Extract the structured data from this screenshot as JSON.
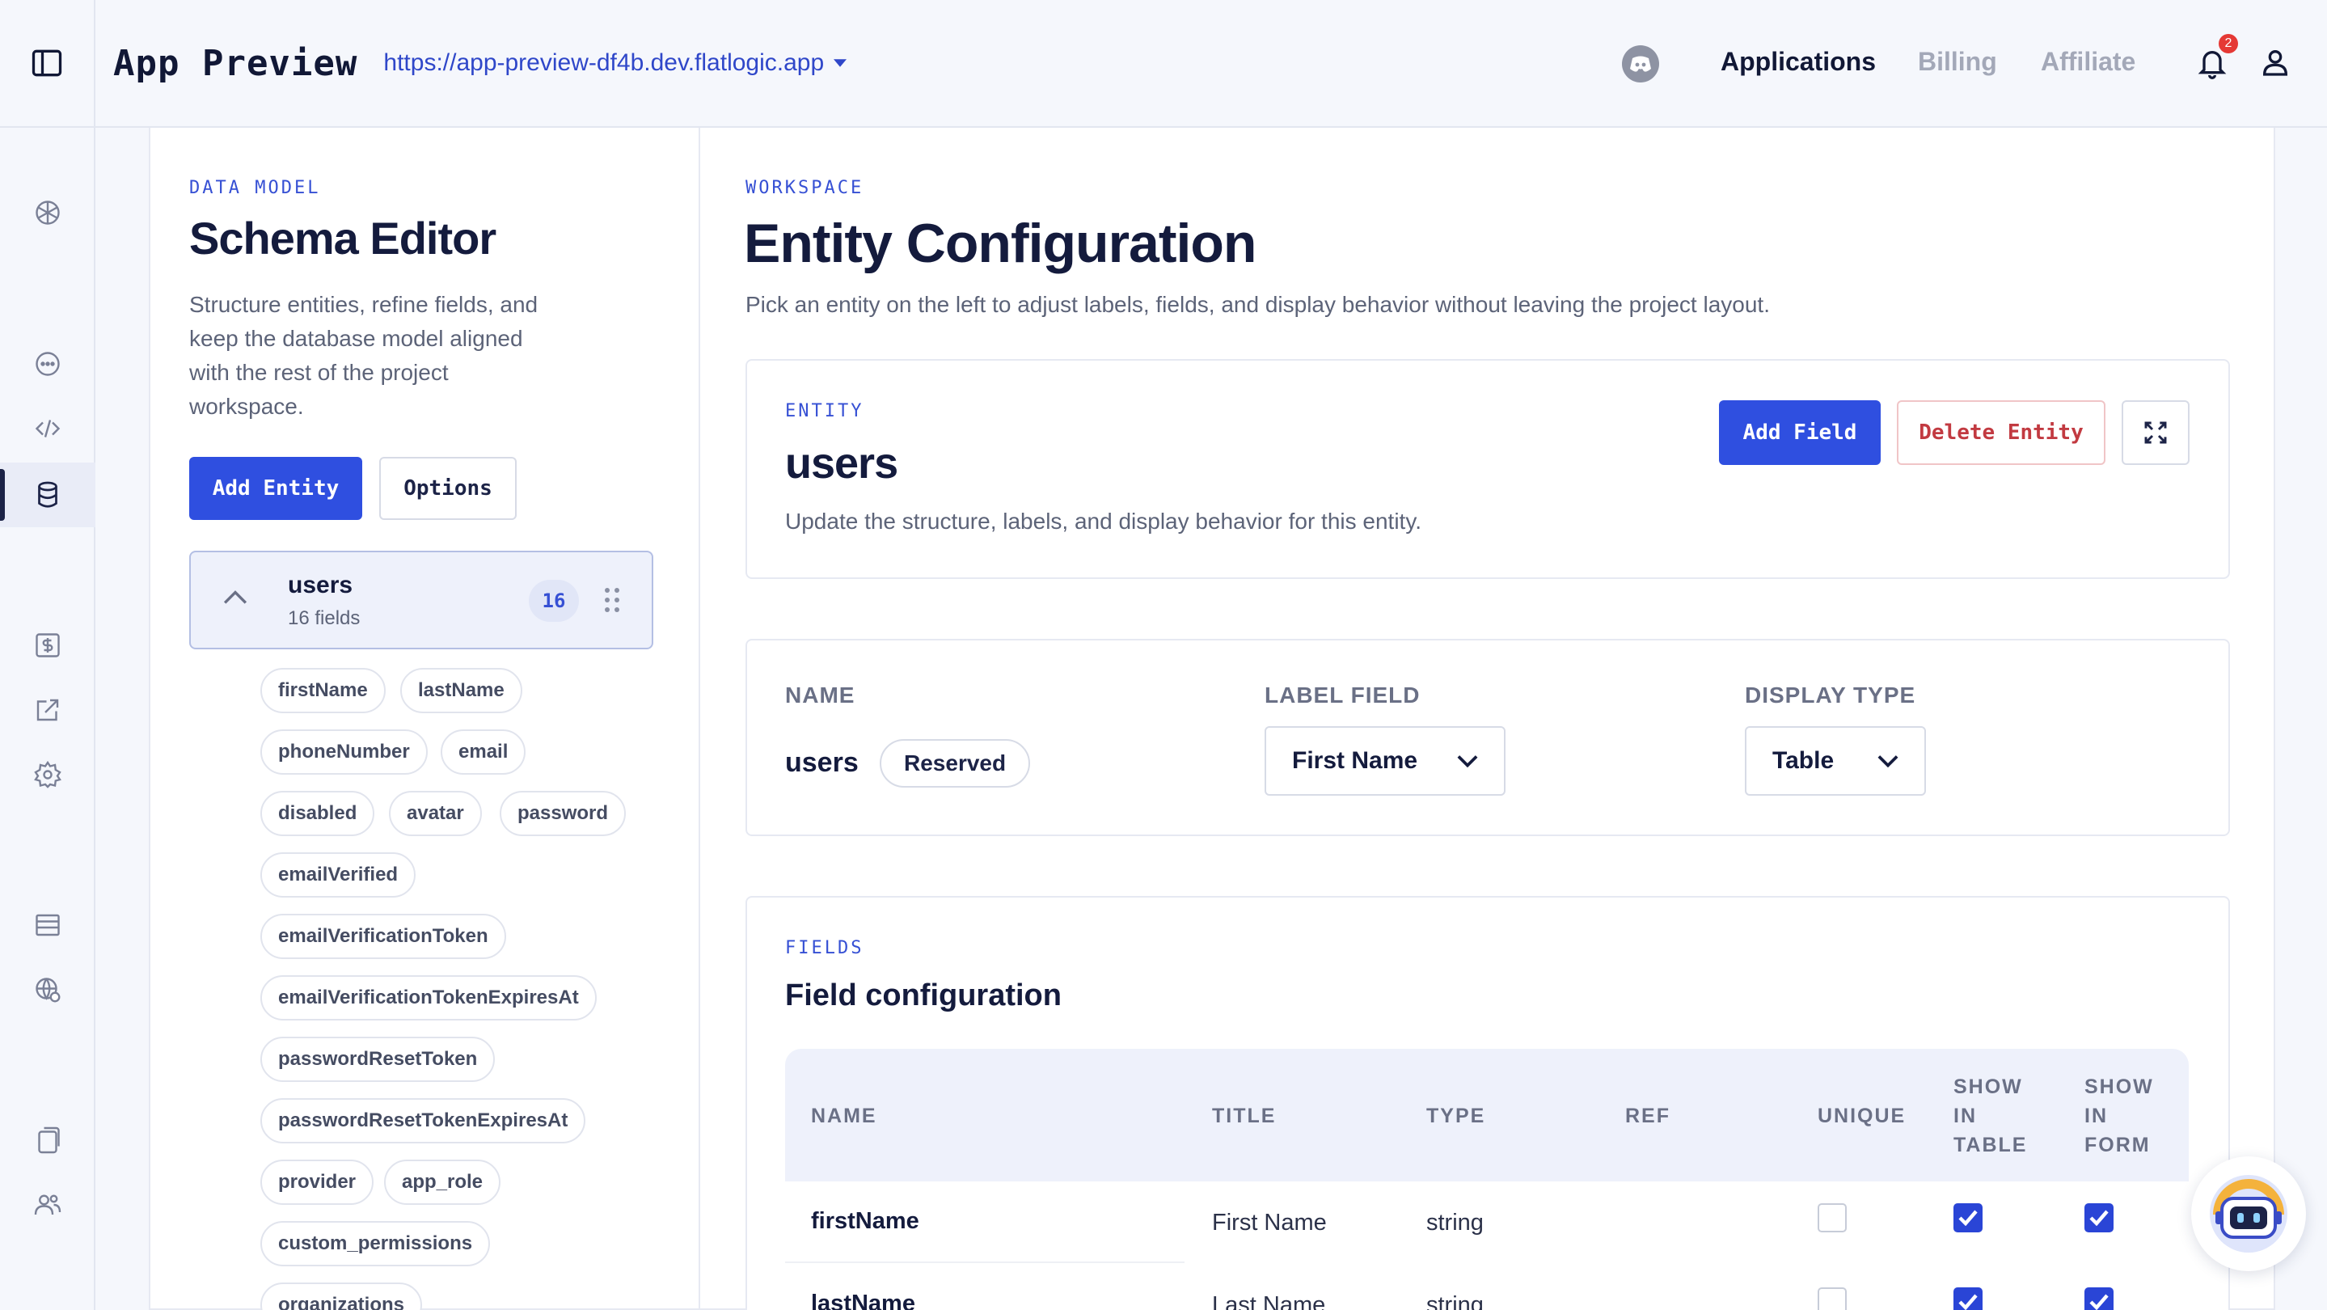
{
  "topbar": {
    "app_title": "App Preview",
    "url": "https://app-preview-df4b.dev.flatlogic.app",
    "nav": [
      "Applications",
      "Billing",
      "Affiliate"
    ],
    "notifications_count": "2"
  },
  "schema": {
    "eyebrow": "DATA MODEL",
    "title": "Schema Editor",
    "description_lines": [
      "Structure entities, refine fields, and",
      "keep the database model aligned",
      "with the rest of the project",
      "workspace."
    ],
    "add_entity": "Add Entity",
    "options": "Options",
    "entity": {
      "name": "users",
      "subtitle": "16 fields",
      "count": "16"
    },
    "fields": [
      "firstName",
      "lastName",
      "phoneNumber",
      "email",
      "disabled",
      "avatar",
      "password",
      "emailVerified",
      "emailVerificationToken",
      "emailVerificationTokenExpiresAt",
      "passwordResetToken",
      "passwordResetTokenExpiresAt",
      "provider",
      "app_role",
      "custom_permissions",
      "organizations"
    ]
  },
  "workspace": {
    "eyebrow": "WORKSPACE",
    "title": "Entity Configuration",
    "description": "Pick an entity on the left to adjust labels, fields, and display behavior without leaving the project layout."
  },
  "entity_card": {
    "eyebrow": "ENTITY",
    "name": "users",
    "description": "Update the structure, labels, and display behavior for this entity.",
    "add_field": "Add Field",
    "delete_entity": "Delete Entity"
  },
  "settings": {
    "name_label": "NAME",
    "name_value": "users",
    "reserved": "Reserved",
    "label_field_label": "LABEL FIELD",
    "label_field_value": "First Name",
    "display_type_label": "DISPLAY TYPE",
    "display_type_value": "Table"
  },
  "fields_card": {
    "eyebrow": "FIELDS",
    "title": "Field configuration",
    "columns": {
      "name": "NAME",
      "title": "TITLE",
      "type": "TYPE",
      "ref": "REF",
      "unique": "UNIQUE",
      "show_in_table": [
        "SHOW",
        "IN",
        "TABLE"
      ],
      "show_in_form": [
        "SHOW",
        "IN",
        "FORM"
      ]
    },
    "rows": [
      {
        "name": "firstName",
        "title": "First Name",
        "type": "string",
        "ref": "",
        "unique": false,
        "show_in_table": true,
        "show_in_form": true
      },
      {
        "name": "lastName",
        "title": "Last Name",
        "type": "string",
        "ref": "",
        "unique": false,
        "show_in_table": true,
        "show_in_form": true
      }
    ]
  },
  "colors": {
    "primary": "#2f4fe0",
    "accent_text": "#3650d4",
    "danger": "#c23a41",
    "background": "#f5f7fc"
  },
  "icons": {
    "rail": [
      "cube-icon",
      "chat-icon",
      "code-icon",
      "database-icon",
      "dollar-icon",
      "external-link-icon",
      "gear-icon",
      "list-icon",
      "globe-icon",
      "copy-icon",
      "users-icon"
    ]
  }
}
